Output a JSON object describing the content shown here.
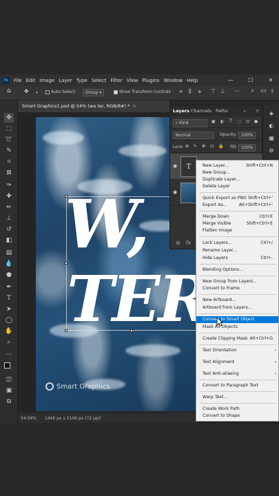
{
  "menubar": {
    "logo": "Ps",
    "items": [
      "File",
      "Edit",
      "Image",
      "Layer",
      "Type",
      "Select",
      "Filter",
      "View",
      "Plugins",
      "Window",
      "Help"
    ],
    "minimize": "—",
    "maximize": "☐",
    "close": "✕"
  },
  "options": {
    "auto_select_label": "Auto-Select:",
    "auto_select_value": "Group",
    "show_transform": "Show Transform Controls"
  },
  "document": {
    "tab_title": "Smart Graphics1.psd @ 54% (wa ter, RGB/8#) *",
    "close": "×",
    "text_line1": "W,",
    "text_line2": "TER",
    "watermark": "Smart Graphics"
  },
  "status": {
    "zoom": "54.04%",
    "info": "1446 px x 2106 px (72 ppi)"
  },
  "layers_panel": {
    "tabs": [
      "Layers",
      "Channels",
      "Paths"
    ],
    "filter_kind": "Kind",
    "blend_mode": "Normal",
    "opacity_label": "Opacity:",
    "opacity_value": "100%",
    "lock_label": "Lock:",
    "fill_label": "Fill:",
    "fill_value": "100%",
    "text_layer_thumb": "T",
    "footer_link": "⊖",
    "footer_fx": "fx"
  },
  "context_menu": {
    "items": [
      {
        "label": "New Layer...",
        "shortcut": "Shift+Ctrl+N"
      },
      {
        "label": "New Group...",
        "shortcut": ""
      },
      {
        "label": "Duplicate Layer...",
        "shortcut": ""
      },
      {
        "label": "Delete Layer",
        "shortcut": ""
      },
      {
        "label": "Quick Export as PNG",
        "shortcut": "Shift+Ctrl+'"
      },
      {
        "label": "Export As...",
        "shortcut": "Alt+Shift+Ctrl+'"
      },
      {
        "label": "Merge Down",
        "shortcut": "Ctrl+E"
      },
      {
        "label": "Merge Visible",
        "shortcut": "Shift+Ctrl+E"
      },
      {
        "label": "Flatten Image",
        "shortcut": ""
      },
      {
        "label": "Lock Layers...",
        "shortcut": "Ctrl+/"
      },
      {
        "label": "Rename Layer...",
        "shortcut": ""
      },
      {
        "label": "Hide Layers",
        "shortcut": "Ctrl+,"
      },
      {
        "label": "Blending Options...",
        "shortcut": ""
      },
      {
        "label": "New Group from Layers...",
        "shortcut": ""
      },
      {
        "label": "Convert to Frame",
        "shortcut": ""
      },
      {
        "label": "New Artboard...",
        "shortcut": ""
      },
      {
        "label": "Artboard from Layers...",
        "shortcut": ""
      },
      {
        "label": "Convert to Smart Object",
        "shortcut": ""
      },
      {
        "label": "Mask All Objects",
        "shortcut": ""
      },
      {
        "label": "Create Clipping Mask",
        "shortcut": "Alt+Ctrl+G"
      },
      {
        "label": "Text Orientation",
        "shortcut": "›"
      },
      {
        "label": "Text Alignment",
        "shortcut": "›"
      },
      {
        "label": "Text Anti-aliasing",
        "shortcut": "›"
      },
      {
        "label": "Convert to Paragraph Text",
        "shortcut": ""
      },
      {
        "label": "Warp Text...",
        "shortcut": ""
      },
      {
        "label": "Create Work Path",
        "shortcut": ""
      },
      {
        "label": "Convert to Shape",
        "shortcut": ""
      }
    ]
  }
}
